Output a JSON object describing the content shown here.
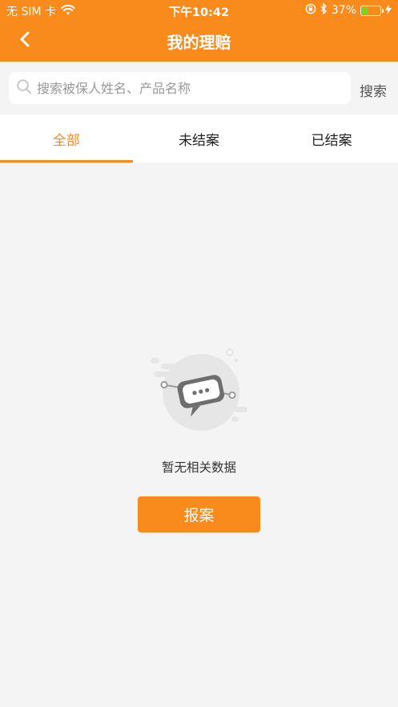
{
  "status_bar": {
    "carrier": "无 SIM 卡",
    "time": "下午10:42",
    "battery_percent": "37%",
    "battery_level": 0.37
  },
  "nav": {
    "title": "我的理赔",
    "back_icon": "chevron-left-icon"
  },
  "search": {
    "placeholder": "搜索被保人姓名、产品名称",
    "button_label": "搜索"
  },
  "tabs": [
    {
      "label": "全部",
      "active": true
    },
    {
      "label": "未结案",
      "active": false
    },
    {
      "label": "已结案",
      "active": false
    }
  ],
  "empty_state": {
    "message": "暂无相关数据",
    "action_label": "报案"
  },
  "colors": {
    "brand": "#f98b1c",
    "background": "#f4f4f4",
    "battery_fill": "#7ed321"
  }
}
